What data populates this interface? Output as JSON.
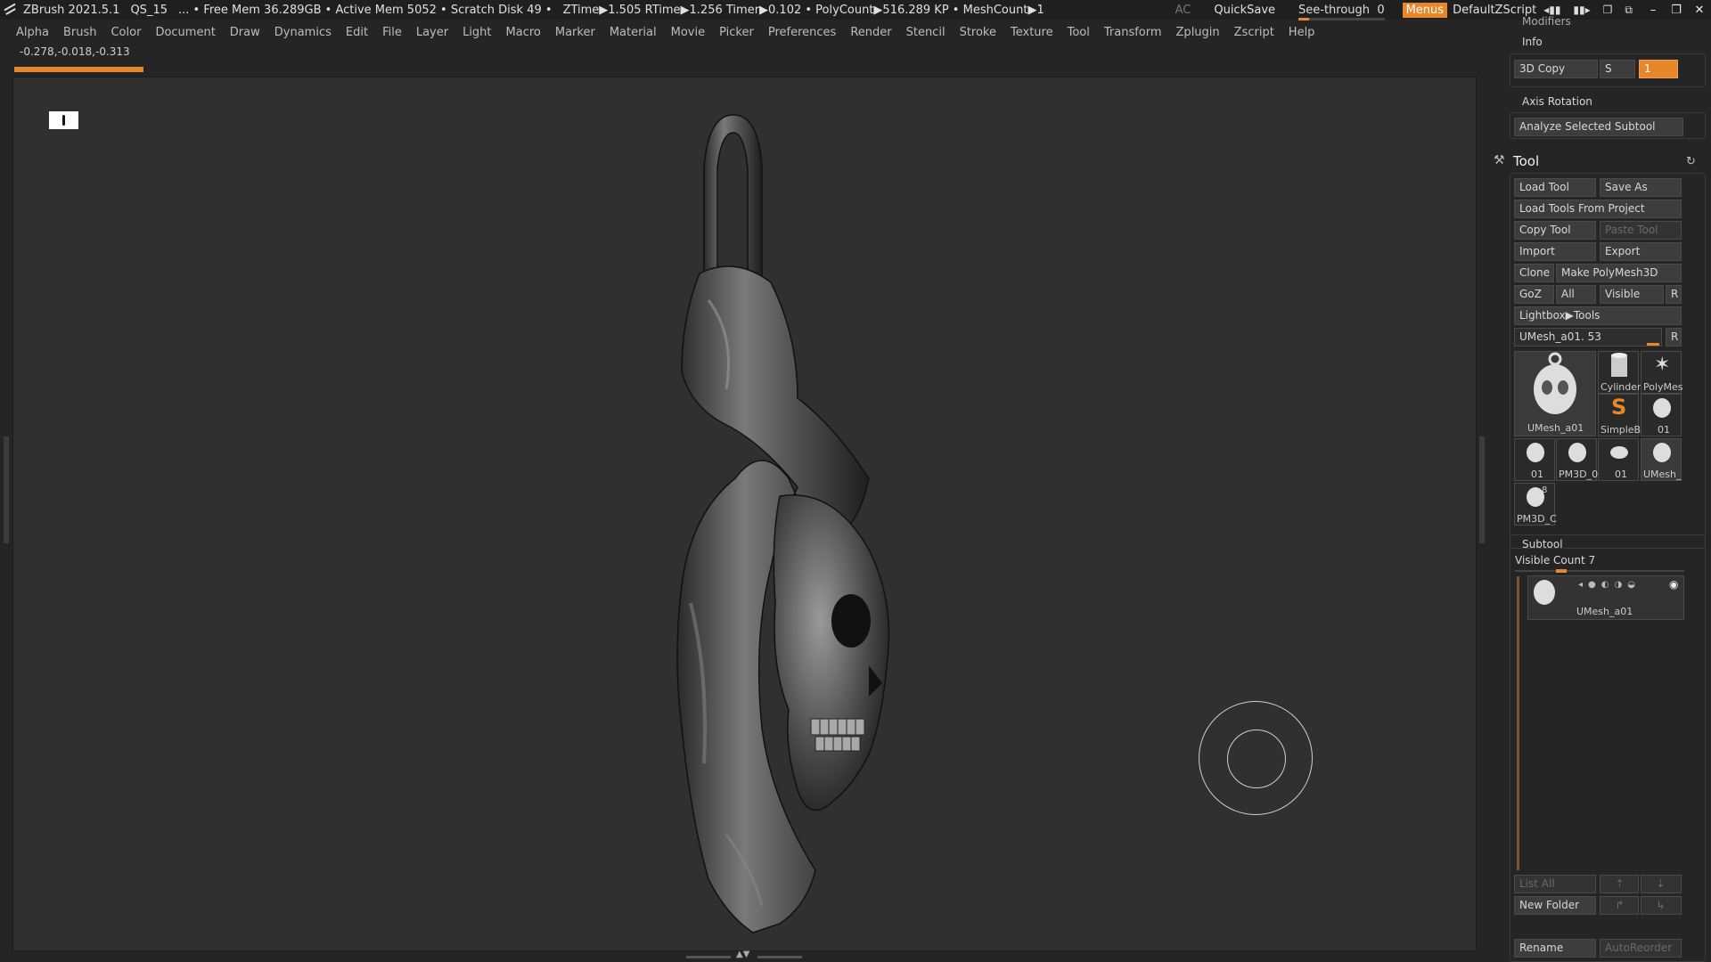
{
  "titlebar": {
    "app": "ZBrush 2021.5.1",
    "doc": "QS_15",
    "free_mem": "... • Free Mem 36.289GB • Active Mem 5052 • Scratch Disk 49 •",
    "stats": "ZTime▶1.505 RTime▶1.256 Timer▶0.102 • PolyCount▶516.289 KP • MeshCount▶1",
    "ac": "AC",
    "quicksave": "QuickSave",
    "seethrough": "See-through",
    "seethrough_value": "0",
    "menus": "Menus",
    "script": "DefaultZScript"
  },
  "menubar": [
    "Alpha",
    "Brush",
    "Color",
    "Document",
    "Draw",
    "Dynamics",
    "Edit",
    "File",
    "Layer",
    "Light",
    "Macro",
    "Marker",
    "Material",
    "Movie",
    "Picker",
    "Preferences",
    "Render",
    "Stencil",
    "Stroke",
    "Texture",
    "Tool",
    "Transform",
    "Zplugin",
    "Zscript",
    "Help"
  ],
  "coords": "-0.278,-0.018,-0.313",
  "panel": {
    "modifiers": "Modifiers",
    "info": "Info",
    "copy3d": "3D Copy",
    "s_label": "S",
    "s_value": "1",
    "axis_rotation": "Axis Rotation",
    "analyze": "Analyze Selected Subtool",
    "tool_title": "Tool",
    "load_tool": "Load Tool",
    "save_as": "Save As",
    "load_from_project": "Load Tools From Project",
    "copy_tool": "Copy Tool",
    "paste_tool": "Paste Tool",
    "import": "Import",
    "export": "Export",
    "clone": "Clone",
    "make_polymesh": "Make PolyMesh3D",
    "goz": "GoZ",
    "all": "All",
    "visible": "Visible",
    "r": "R",
    "lightbox_tools": "Lightbox▶Tools",
    "current_tool": "UMesh_a01. 53",
    "thumbs": {
      "main": "UMesh_a01",
      "cylinder": "Cylinder",
      "polymesh": "PolyMes",
      "simpleb": "SimpleB",
      "t01a": "01",
      "t01b": "01",
      "pm3d0": "PM3D_0",
      "t01c": "01",
      "umesh": "UMesh_",
      "pm3dc": "PM3D_C",
      "badge": "8"
    },
    "subtool_title": "Subtool",
    "visible_count": "Visible Count 7",
    "subtool_item": "UMesh_a01",
    "list_all": "List All",
    "new_folder": "New Folder",
    "rename": "Rename",
    "autoreorder": "AutoReorder"
  },
  "colors": {
    "accent": "#e8862a",
    "bg": "#252525",
    "viewport": "#303030"
  }
}
